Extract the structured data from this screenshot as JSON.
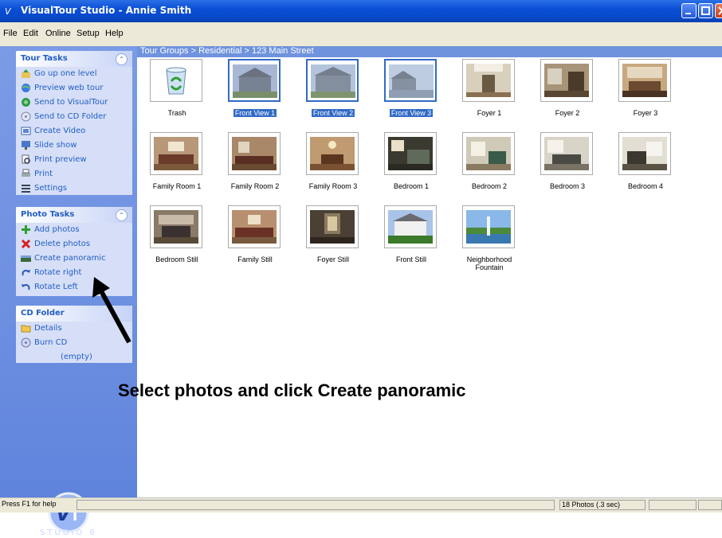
{
  "window": {
    "title": "VisualTour Studio - Annie Smith"
  },
  "menu": [
    "File",
    "Edit",
    "Online",
    "Setup",
    "Help"
  ],
  "sidebar": {
    "tour_tasks": {
      "title": "Tour Tasks",
      "items": [
        "Go up one level",
        "Preview web tour",
        "Send to VisualTour",
        "Send to CD Folder",
        "Create Video",
        "Slide show",
        "Print preview",
        "Print",
        "Settings"
      ]
    },
    "photo_tasks": {
      "title": "Photo Tasks",
      "items": [
        "Add photos",
        "Delete photos",
        "Create panoramic",
        "Rotate right",
        "Rotate Left"
      ]
    },
    "cd_folder": {
      "title": "CD Folder",
      "items": [
        "Details",
        "Burn CD"
      ],
      "empty_label": "(empty)"
    },
    "logo_text": "STUDIO 6"
  },
  "breadcrumb": "Tour Groups > Residential > 123 Main Street",
  "photos": [
    {
      "label": "Trash",
      "selected": false,
      "icon": "trash-icon"
    },
    {
      "label": "Front View 1",
      "selected": true
    },
    {
      "label": "Front View 2",
      "selected": true
    },
    {
      "label": "Front View 3",
      "selected": true
    },
    {
      "label": "Foyer 1",
      "selected": false
    },
    {
      "label": "Foyer 2",
      "selected": false
    },
    {
      "label": "Foyer 3",
      "selected": false
    },
    {
      "label": "Family Room 1",
      "selected": false
    },
    {
      "label": "Family Room 2",
      "selected": false
    },
    {
      "label": "Family Room 3",
      "selected": false
    },
    {
      "label": "Bedroom 1",
      "selected": false
    },
    {
      "label": "Bedroom 2",
      "selected": false
    },
    {
      "label": "Bedroom 3",
      "selected": false
    },
    {
      "label": "Bedroom 4",
      "selected": false
    },
    {
      "label": "Bedroom Still",
      "selected": false
    },
    {
      "label": "Family Still",
      "selected": false
    },
    {
      "label": "Foyer Still",
      "selected": false
    },
    {
      "label": "Front Still",
      "selected": false
    },
    {
      "label": "Neighborhood Fountain",
      "selected": false
    }
  ],
  "annotation": "Select photos and click Create panoramic",
  "status": {
    "help": "Press F1 for help",
    "count": "18 Photos (.3 sec)"
  },
  "colors": {
    "title_bar": "#0a4fd6",
    "sidebar": "#6d8fe0",
    "selection": "#316ac5",
    "task_link": "#215dc6"
  }
}
